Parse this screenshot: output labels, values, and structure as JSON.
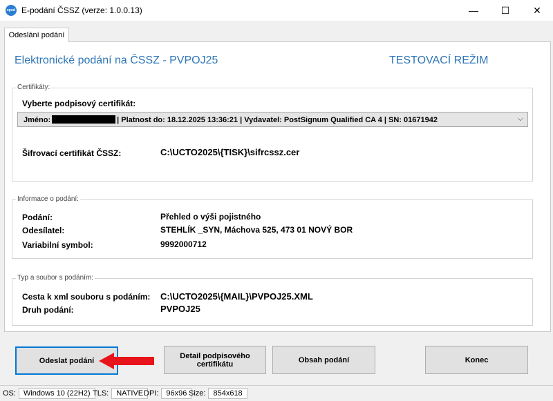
{
  "window": {
    "title": "E-podání ČSSZ (verze: 1.0.0.13)",
    "icon_text": "epod",
    "minimize": "—",
    "maximize": "☐",
    "close": "✕"
  },
  "tab": {
    "label": "Odeslání podání"
  },
  "header": {
    "title": "Elektronické podání na ČSSZ - PVPOJ25",
    "mode": "TESTOVACÍ REŽIM"
  },
  "certificates": {
    "group_label": "Certifikáty:",
    "select_label": "Vyberte podpisový certifikát:",
    "select_prefix": "Jméno:",
    "select_rest": "| Platnost do: 18.12.2025 13:36:21 | Vydavatel: PostSignum Qualified CA 4 | SN: 01671942",
    "encryption_label": "Šifrovací certifikát ČSSZ:",
    "encryption_value": "C:\\UCTO2025\\{TISK}\\sifrcssz.cer"
  },
  "info": {
    "group_label": "Informace o podání:",
    "rows": [
      {
        "label": "Podání:",
        "value": "Přehled o výši pojistného"
      },
      {
        "label": "Odesílatel:",
        "value": "STEHLÍK _SYN, Máchova 525, 473 01 NOVÝ BOR"
      },
      {
        "label": "Variabilní symbol:",
        "value": "9992000712"
      }
    ]
  },
  "file": {
    "group_label": "Typ a soubor s podáním:",
    "rows": [
      {
        "label": "Cesta k xml souboru s podáním:",
        "value": "C:\\UCTO2025\\{MAIL}\\PVPOJ25.XML"
      },
      {
        "label": "Druh podání:",
        "value": "PVPOJ25"
      }
    ]
  },
  "buttons": {
    "send": "Odeslat podání",
    "detail_line1": "Detail podpisového",
    "detail_line2": "certifikátu",
    "content": "Obsah podání",
    "end": "Konec"
  },
  "status": {
    "os_label": "OS:",
    "os_value": "Windows 10 (22H2)",
    "tls_label": "TLS:",
    "tls_value": "NATIVE",
    "dpi_label": "DPI:",
    "dpi_value": "96x96",
    "size_label": "Size:",
    "size_value": "854x618"
  },
  "colors": {
    "accent": "#2e75b6",
    "arrow": "#e8141c",
    "focus_border": "#0078d7"
  }
}
